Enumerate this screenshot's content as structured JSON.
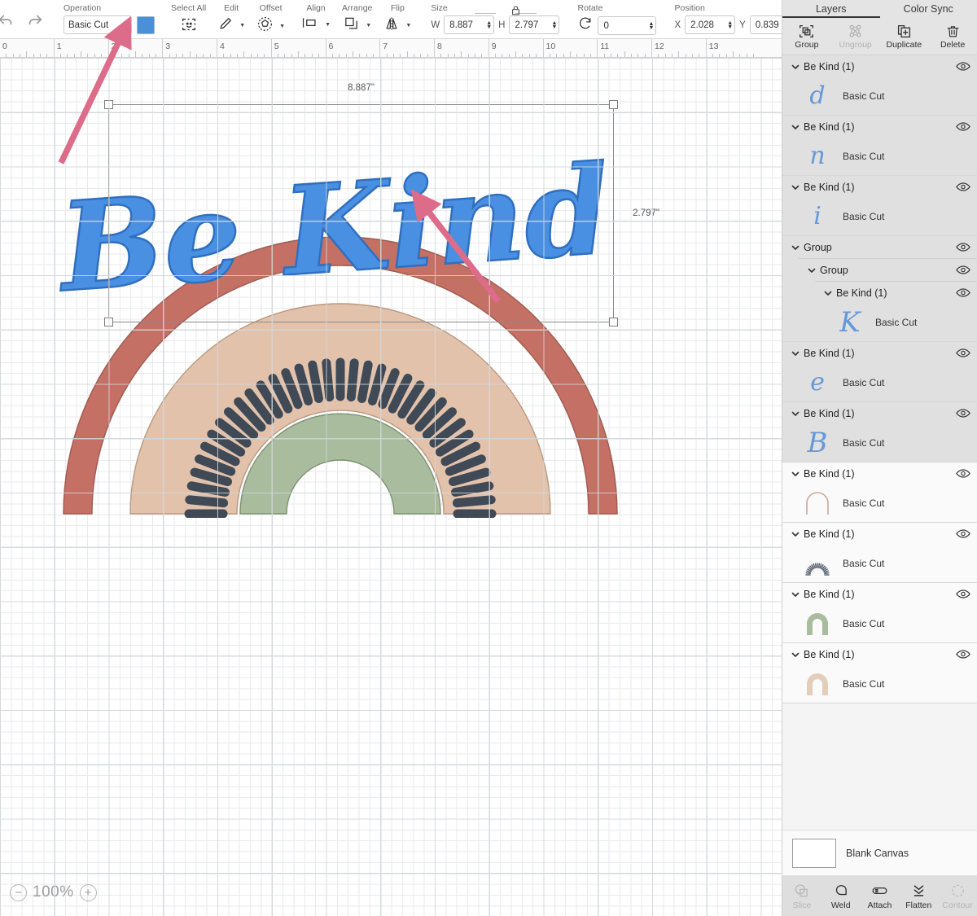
{
  "toolbar": {
    "undo_icon": "undo-arrow-icon",
    "redo_icon": "redo-arrow-icon",
    "operation": {
      "label": "Operation",
      "value": "Basic Cut",
      "caret": "▼",
      "swatch_color": "#4a90d9"
    },
    "select_all": {
      "label": "Select All",
      "icon": "select-all-icon"
    },
    "edit": {
      "label": "Edit",
      "icon": "pencil-icon",
      "caret": "▼"
    },
    "offset": {
      "label": "Offset",
      "icon": "offset-icon",
      "caret": "▼"
    },
    "align": {
      "label": "Align",
      "icon": "align-icon",
      "caret": "▼"
    },
    "arrange": {
      "label": "Arrange",
      "icon": "arrange-icon",
      "caret": "▼"
    },
    "flip": {
      "label": "Flip",
      "icon": "flip-icon",
      "caret": "▼"
    },
    "size": {
      "label": "Size",
      "w_label": "W",
      "w_value": "8.887",
      "h_label": "H",
      "h_value": "2.797",
      "lock_icon": "lock-closed-icon"
    },
    "rotate": {
      "label": "Rotate",
      "icon": "rotate-icon",
      "value": "0"
    },
    "position": {
      "label": "Position",
      "x_label": "X",
      "x_value": "2.028",
      "y_label": "Y",
      "y_value": "0.839"
    }
  },
  "ruler": {
    "unit": "in",
    "numbers": [
      "0",
      "1",
      "2",
      "3",
      "4",
      "5",
      "6",
      "7",
      "8",
      "9",
      "10",
      "11",
      "12",
      "13"
    ]
  },
  "canvas": {
    "selection": {
      "width_label": "8.887\"",
      "height_label": "2.797\""
    },
    "artwork_text": "Be Kind",
    "colors": {
      "text_blue": "#4a90e2",
      "outer_arc": "#c47064",
      "tan_arc": "#e3c2ac",
      "sage_arc": "#a9bc9d",
      "dash_slate": "#3f4a56",
      "annotation_arrow": "#dd6b8a"
    },
    "zoom": {
      "minus": "−",
      "percent": "100%",
      "plus": "+"
    }
  },
  "panel": {
    "tabs": [
      {
        "label": "Layers",
        "active": true
      },
      {
        "label": "Color Sync",
        "active": false
      }
    ],
    "actions": [
      {
        "label": "Group",
        "icon": "group-icon",
        "disabled": false
      },
      {
        "label": "Ungroup",
        "icon": "ungroup-icon",
        "disabled": true
      },
      {
        "label": "Duplicate",
        "icon": "duplicate-icon",
        "disabled": false
      },
      {
        "label": "Delete",
        "icon": "trash-icon",
        "disabled": false
      }
    ],
    "layers": [
      {
        "name": "Be Kind (1)",
        "cut": "Basic Cut",
        "glyph": "d",
        "kind": "letter",
        "shade": "gray",
        "indent": 0
      },
      {
        "name": "Be Kind (1)",
        "cut": "Basic Cut",
        "glyph": "n",
        "kind": "letter",
        "shade": "gray",
        "indent": 0
      },
      {
        "name": "Be Kind (1)",
        "cut": "Basic Cut",
        "glyph": "i",
        "kind": "letter",
        "shade": "gray",
        "indent": 0
      },
      {
        "name": "Group",
        "cut": "",
        "glyph": "",
        "kind": "group",
        "shade": "gray",
        "indent": 0
      },
      {
        "name": "Group",
        "cut": "",
        "glyph": "",
        "kind": "group",
        "shade": "gray",
        "indent": 1
      },
      {
        "name": "Be Kind (1)",
        "cut": "Basic Cut",
        "glyph": "K",
        "kind": "letter",
        "shade": "gray",
        "indent": 2
      },
      {
        "name": "Be Kind (1)",
        "cut": "Basic Cut",
        "glyph": "e",
        "kind": "letter",
        "shade": "gray",
        "indent": 0
      },
      {
        "name": "Be Kind (1)",
        "cut": "Basic Cut",
        "glyph": "B",
        "kind": "letter",
        "shade": "gray",
        "indent": 0
      },
      {
        "name": "Be Kind (1)",
        "cut": "Basic Cut",
        "glyph": "arc-outline",
        "kind": "shape",
        "shade": "white",
        "indent": 0
      },
      {
        "name": "Be Kind (1)",
        "cut": "Basic Cut",
        "glyph": "arc-dashes",
        "kind": "shape",
        "shade": "white",
        "indent": 0
      },
      {
        "name": "Be Kind (1)",
        "cut": "Basic Cut",
        "glyph": "arc-sage",
        "kind": "shape",
        "shade": "white",
        "indent": 0
      },
      {
        "name": "Be Kind (1)",
        "cut": "Basic Cut",
        "glyph": "arc-tan",
        "kind": "shape",
        "shade": "white",
        "indent": 0
      }
    ],
    "canvas_row": {
      "label": "Blank Canvas",
      "thumb": "white-canvas-thumb"
    },
    "bottom_ops": [
      {
        "label": "Slice",
        "icon": "slice-icon",
        "disabled": true
      },
      {
        "label": "Weld",
        "icon": "weld-icon",
        "disabled": false
      },
      {
        "label": "Attach",
        "icon": "attach-icon",
        "disabled": false
      },
      {
        "label": "Flatten",
        "icon": "flatten-icon",
        "disabled": false
      },
      {
        "label": "Contour",
        "icon": "contour-icon",
        "disabled": true
      }
    ]
  }
}
